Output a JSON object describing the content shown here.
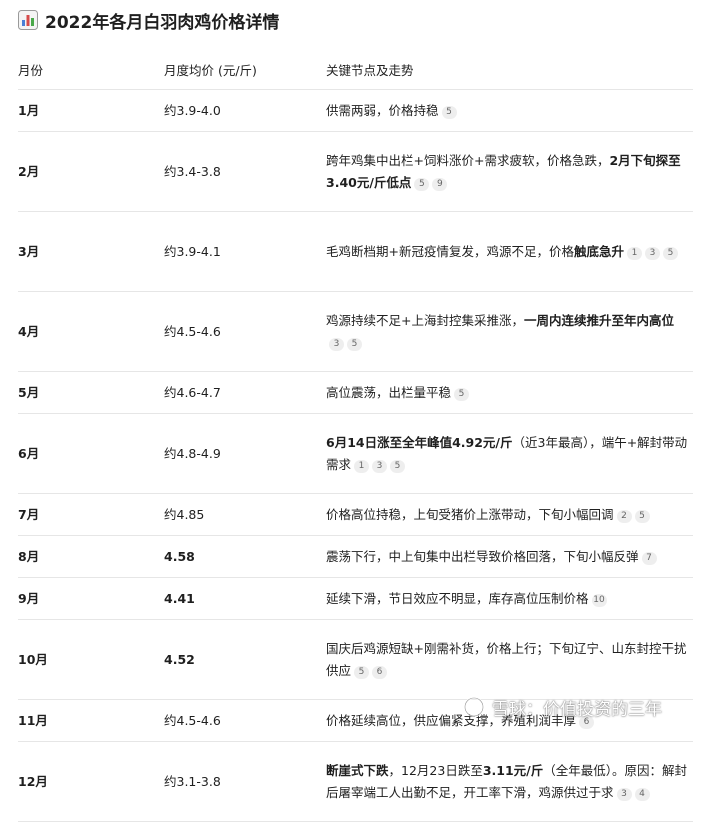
{
  "title": "2022年各月白羽肉鸡价格详情",
  "title_icon": "bar-chart-icon",
  "headers": [
    "月份",
    "月度均价 (元/斤)",
    "关键节点及走势"
  ],
  "rows": [
    {
      "month": "1月",
      "price": "约3.9-4.0",
      "price_bold": false,
      "parts": [
        {
          "t": "供需两弱，价格持稳",
          "b": false
        }
      ],
      "cites": [
        "5"
      ]
    },
    {
      "month": "2月",
      "price": "约3.4-3.8",
      "price_bold": false,
      "parts": [
        {
          "t": "跨年鸡集中出栏+饲料涨价+需求疲软，价格急跌，",
          "b": false
        },
        {
          "t": "2月下旬探至3.40元/斤低点",
          "b": true
        }
      ],
      "cites": [
        "5",
        "9"
      ]
    },
    {
      "month": "3月",
      "price": "约3.9-4.1",
      "price_bold": false,
      "parts": [
        {
          "t": "毛鸡断档期+新冠疫情复发，鸡源不足，价格",
          "b": false
        },
        {
          "t": "触底急升",
          "b": true
        }
      ],
      "cites": [
        "1",
        "3",
        "5"
      ]
    },
    {
      "month": "4月",
      "price": "约4.5-4.6",
      "price_bold": false,
      "parts": [
        {
          "t": "鸡源持续不足+上海封控集采推涨，",
          "b": false
        },
        {
          "t": "一周内连续推升至年内高位",
          "b": true
        }
      ],
      "cites": [
        "3",
        "5"
      ]
    },
    {
      "month": "5月",
      "price": "约4.6-4.7",
      "price_bold": false,
      "parts": [
        {
          "t": "高位震荡，出栏量平稳",
          "b": false
        }
      ],
      "cites": [
        "5"
      ]
    },
    {
      "month": "6月",
      "price": "约4.8-4.9",
      "price_bold": false,
      "parts": [
        {
          "t": "6月14日涨至全年峰值4.92元/斤",
          "b": true
        },
        {
          "t": "（近3年最高），端午+解封带动需求",
          "b": false
        }
      ],
      "cites": [
        "1",
        "3",
        "5"
      ]
    },
    {
      "month": "7月",
      "price": "约4.85",
      "price_bold": false,
      "parts": [
        {
          "t": "价格高位持稳，上旬受猪价上涨带动，下旬小幅回调",
          "b": false
        }
      ],
      "cites": [
        "2",
        "5"
      ]
    },
    {
      "month": "8月",
      "price": "4.58",
      "price_bold": true,
      "parts": [
        {
          "t": "震荡下行，中上旬集中出栏导致价格回落，下旬小幅反弹",
          "b": false
        }
      ],
      "cites": [
        "7"
      ]
    },
    {
      "month": "9月",
      "price": "4.41",
      "price_bold": true,
      "parts": [
        {
          "t": "延续下滑，节日效应不明显，库存高位压制价格",
          "b": false
        }
      ],
      "cites": [
        "10"
      ]
    },
    {
      "month": "10月",
      "price": "4.52",
      "price_bold": true,
      "parts": [
        {
          "t": "国庆后鸡源短缺+刚需补货，价格上行；下旬辽宁、山东封控干扰供应",
          "b": false
        }
      ],
      "cites": [
        "5",
        "6"
      ]
    },
    {
      "month": "11月",
      "price": "约4.5-4.6",
      "price_bold": false,
      "parts": [
        {
          "t": "价格延续高位，供应偏紧支撑，养殖利润丰厚",
          "b": false
        }
      ],
      "cites": [
        "6"
      ]
    },
    {
      "month": "12月",
      "price": "约3.1-3.8",
      "price_bold": false,
      "parts": [
        {
          "t": "断崖式下跌",
          "b": true
        },
        {
          "t": "，12月23日跌至",
          "b": false
        },
        {
          "t": "3.11元/斤",
          "b": true
        },
        {
          "t": "（全年最低）。原因：解封后屠宰端工人出勤不足，开工率下滑，鸡源供过于求",
          "b": false
        }
      ],
      "cites": [
        "3",
        "4"
      ]
    }
  ],
  "watermark": "雪球：价值投资的三年"
}
